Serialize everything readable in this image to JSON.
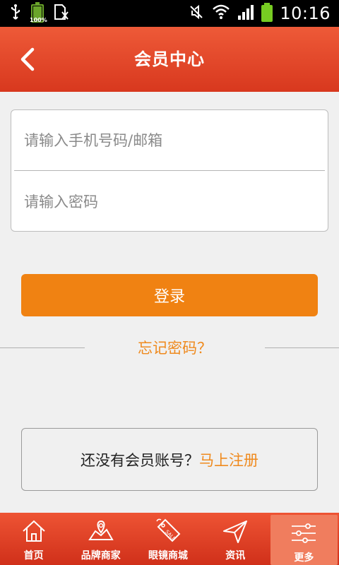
{
  "status_bar": {
    "battery_small_label": "100%",
    "time": "10:16"
  },
  "header": {
    "title": "会员中心",
    "color_top": "#ee5a38",
    "color_bottom": "#d8381e"
  },
  "login_form": {
    "phone_placeholder": "请输入手机号码/邮箱",
    "password_placeholder": "请输入密码",
    "login_label": "登录",
    "forgot_label": "忘记密码？"
  },
  "register": {
    "prompt": "还没有会员账号？",
    "link": "马上注册"
  },
  "accent_color": "#f08212",
  "tabs": [
    {
      "label": "首页",
      "icon": "home-icon"
    },
    {
      "label": "品牌商家",
      "icon": "map-pin-icon"
    },
    {
      "label": "眼镜商城",
      "icon": "sale-tag-icon"
    },
    {
      "label": "资讯",
      "icon": "paper-plane-icon"
    },
    {
      "label": "更多",
      "icon": "sliders-icon",
      "active": true
    }
  ]
}
